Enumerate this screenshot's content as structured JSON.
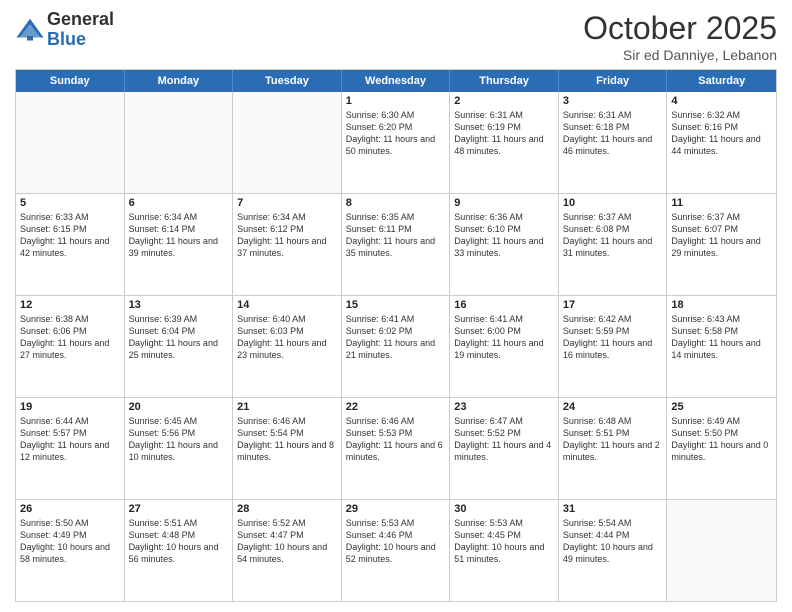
{
  "header": {
    "logo_general": "General",
    "logo_blue": "Blue",
    "month_title": "October 2025",
    "subtitle": "Sir ed Danniye, Lebanon"
  },
  "days_of_week": [
    "Sunday",
    "Monday",
    "Tuesday",
    "Wednesday",
    "Thursday",
    "Friday",
    "Saturday"
  ],
  "weeks": [
    [
      {
        "day": "",
        "empty": true
      },
      {
        "day": "",
        "empty": true
      },
      {
        "day": "",
        "empty": true
      },
      {
        "day": "1",
        "sunrise": "Sunrise: 6:30 AM",
        "sunset": "Sunset: 6:20 PM",
        "daylight": "Daylight: 11 hours and 50 minutes."
      },
      {
        "day": "2",
        "sunrise": "Sunrise: 6:31 AM",
        "sunset": "Sunset: 6:19 PM",
        "daylight": "Daylight: 11 hours and 48 minutes."
      },
      {
        "day": "3",
        "sunrise": "Sunrise: 6:31 AM",
        "sunset": "Sunset: 6:18 PM",
        "daylight": "Daylight: 11 hours and 46 minutes."
      },
      {
        "day": "4",
        "sunrise": "Sunrise: 6:32 AM",
        "sunset": "Sunset: 6:16 PM",
        "daylight": "Daylight: 11 hours and 44 minutes."
      }
    ],
    [
      {
        "day": "5",
        "sunrise": "Sunrise: 6:33 AM",
        "sunset": "Sunset: 6:15 PM",
        "daylight": "Daylight: 11 hours and 42 minutes."
      },
      {
        "day": "6",
        "sunrise": "Sunrise: 6:34 AM",
        "sunset": "Sunset: 6:14 PM",
        "daylight": "Daylight: 11 hours and 39 minutes."
      },
      {
        "day": "7",
        "sunrise": "Sunrise: 6:34 AM",
        "sunset": "Sunset: 6:12 PM",
        "daylight": "Daylight: 11 hours and 37 minutes."
      },
      {
        "day": "8",
        "sunrise": "Sunrise: 6:35 AM",
        "sunset": "Sunset: 6:11 PM",
        "daylight": "Daylight: 11 hours and 35 minutes."
      },
      {
        "day": "9",
        "sunrise": "Sunrise: 6:36 AM",
        "sunset": "Sunset: 6:10 PM",
        "daylight": "Daylight: 11 hours and 33 minutes."
      },
      {
        "day": "10",
        "sunrise": "Sunrise: 6:37 AM",
        "sunset": "Sunset: 6:08 PM",
        "daylight": "Daylight: 11 hours and 31 minutes."
      },
      {
        "day": "11",
        "sunrise": "Sunrise: 6:37 AM",
        "sunset": "Sunset: 6:07 PM",
        "daylight": "Daylight: 11 hours and 29 minutes."
      }
    ],
    [
      {
        "day": "12",
        "sunrise": "Sunrise: 6:38 AM",
        "sunset": "Sunset: 6:06 PM",
        "daylight": "Daylight: 11 hours and 27 minutes."
      },
      {
        "day": "13",
        "sunrise": "Sunrise: 6:39 AM",
        "sunset": "Sunset: 6:04 PM",
        "daylight": "Daylight: 11 hours and 25 minutes."
      },
      {
        "day": "14",
        "sunrise": "Sunrise: 6:40 AM",
        "sunset": "Sunset: 6:03 PM",
        "daylight": "Daylight: 11 hours and 23 minutes."
      },
      {
        "day": "15",
        "sunrise": "Sunrise: 6:41 AM",
        "sunset": "Sunset: 6:02 PM",
        "daylight": "Daylight: 11 hours and 21 minutes."
      },
      {
        "day": "16",
        "sunrise": "Sunrise: 6:41 AM",
        "sunset": "Sunset: 6:00 PM",
        "daylight": "Daylight: 11 hours and 19 minutes."
      },
      {
        "day": "17",
        "sunrise": "Sunrise: 6:42 AM",
        "sunset": "Sunset: 5:59 PM",
        "daylight": "Daylight: 11 hours and 16 minutes."
      },
      {
        "day": "18",
        "sunrise": "Sunrise: 6:43 AM",
        "sunset": "Sunset: 5:58 PM",
        "daylight": "Daylight: 11 hours and 14 minutes."
      }
    ],
    [
      {
        "day": "19",
        "sunrise": "Sunrise: 6:44 AM",
        "sunset": "Sunset: 5:57 PM",
        "daylight": "Daylight: 11 hours and 12 minutes."
      },
      {
        "day": "20",
        "sunrise": "Sunrise: 6:45 AM",
        "sunset": "Sunset: 5:56 PM",
        "daylight": "Daylight: 11 hours and 10 minutes."
      },
      {
        "day": "21",
        "sunrise": "Sunrise: 6:46 AM",
        "sunset": "Sunset: 5:54 PM",
        "daylight": "Daylight: 11 hours and 8 minutes."
      },
      {
        "day": "22",
        "sunrise": "Sunrise: 6:46 AM",
        "sunset": "Sunset: 5:53 PM",
        "daylight": "Daylight: 11 hours and 6 minutes."
      },
      {
        "day": "23",
        "sunrise": "Sunrise: 6:47 AM",
        "sunset": "Sunset: 5:52 PM",
        "daylight": "Daylight: 11 hours and 4 minutes."
      },
      {
        "day": "24",
        "sunrise": "Sunrise: 6:48 AM",
        "sunset": "Sunset: 5:51 PM",
        "daylight": "Daylight: 11 hours and 2 minutes."
      },
      {
        "day": "25",
        "sunrise": "Sunrise: 6:49 AM",
        "sunset": "Sunset: 5:50 PM",
        "daylight": "Daylight: 11 hours and 0 minutes."
      }
    ],
    [
      {
        "day": "26",
        "sunrise": "Sunrise: 5:50 AM",
        "sunset": "Sunset: 4:49 PM",
        "daylight": "Daylight: 10 hours and 58 minutes."
      },
      {
        "day": "27",
        "sunrise": "Sunrise: 5:51 AM",
        "sunset": "Sunset: 4:48 PM",
        "daylight": "Daylight: 10 hours and 56 minutes."
      },
      {
        "day": "28",
        "sunrise": "Sunrise: 5:52 AM",
        "sunset": "Sunset: 4:47 PM",
        "daylight": "Daylight: 10 hours and 54 minutes."
      },
      {
        "day": "29",
        "sunrise": "Sunrise: 5:53 AM",
        "sunset": "Sunset: 4:46 PM",
        "daylight": "Daylight: 10 hours and 52 minutes."
      },
      {
        "day": "30",
        "sunrise": "Sunrise: 5:53 AM",
        "sunset": "Sunset: 4:45 PM",
        "daylight": "Daylight: 10 hours and 51 minutes."
      },
      {
        "day": "31",
        "sunrise": "Sunrise: 5:54 AM",
        "sunset": "Sunset: 4:44 PM",
        "daylight": "Daylight: 10 hours and 49 minutes."
      },
      {
        "day": "",
        "empty": true
      }
    ]
  ]
}
